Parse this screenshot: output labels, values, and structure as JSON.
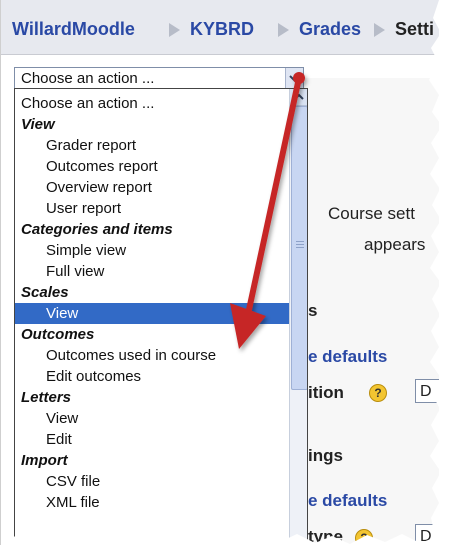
{
  "breadcrumb": {
    "items": [
      "WillardMoodle",
      "KYBRD",
      "Grades"
    ],
    "current": "Setti"
  },
  "action_select": {
    "value": "Choose an action ..."
  },
  "dropdown": {
    "options": [
      {
        "label": "Choose an action ...",
        "kind": "first"
      },
      {
        "label": "View",
        "kind": "group"
      },
      {
        "label": "Grader report",
        "kind": "child"
      },
      {
        "label": "Outcomes report",
        "kind": "child"
      },
      {
        "label": "Overview report",
        "kind": "child"
      },
      {
        "label": "User report",
        "kind": "child"
      },
      {
        "label": "Categories and items",
        "kind": "group"
      },
      {
        "label": "Simple view",
        "kind": "child"
      },
      {
        "label": "Full view",
        "kind": "child"
      },
      {
        "label": "Scales",
        "kind": "group"
      },
      {
        "label": "View",
        "kind": "child",
        "selected": true
      },
      {
        "label": "Outcomes",
        "kind": "group"
      },
      {
        "label": "Outcomes used in course",
        "kind": "child"
      },
      {
        "label": "Edit outcomes",
        "kind": "child"
      },
      {
        "label": "Letters",
        "kind": "group"
      },
      {
        "label": "View",
        "kind": "child"
      },
      {
        "label": "Edit",
        "kind": "child"
      },
      {
        "label": "Import",
        "kind": "group"
      },
      {
        "label": "CSV file",
        "kind": "child"
      },
      {
        "label": "XML file",
        "kind": "child"
      }
    ]
  },
  "background": {
    "course_setting": "Course sett",
    "appears": "appears",
    "s": "s",
    "defaults_1": "e defaults",
    "position": "ition",
    "ings": "ings",
    "defaults_2": "e defaults",
    "type": "type",
    "select_value": "D"
  },
  "colors": {
    "link": "#2a49a5",
    "selection": "#326ac6",
    "arrow": "#c62828"
  }
}
